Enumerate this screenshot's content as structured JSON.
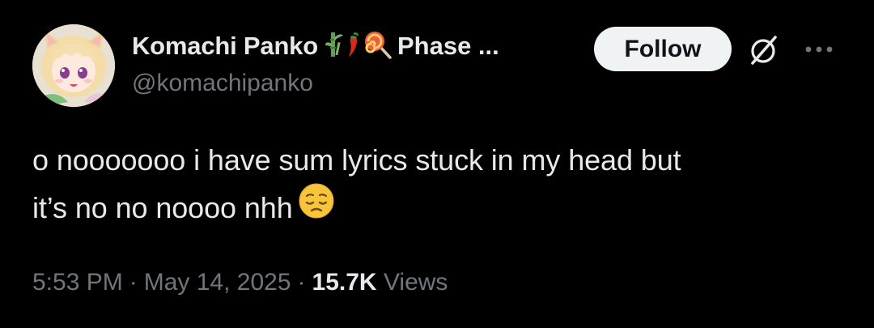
{
  "user": {
    "display_name": "Komachi Panko",
    "name_suffix": "Phase ...",
    "handle": "@komachipanko",
    "name_emojis": [
      "bamboo-icon",
      "chili-pepper-icon",
      "lollipop-icon"
    ]
  },
  "actions": {
    "follow_label": "Follow",
    "grok_icon": "grok-icon",
    "more_icon": "more-icon"
  },
  "tweet": {
    "line1": "o nooooooo i have sum lyrics stuck in my head but",
    "line2": "it’s no no noooo nhh",
    "emoji": "pensive-face-icon"
  },
  "meta": {
    "time": "5:53 PM",
    "date": "May 14, 2025",
    "separator": "·",
    "views_count": "15.7K",
    "views_label": "Views"
  },
  "colors": {
    "background": "#000000",
    "text_primary": "#e7e9ea",
    "text_secondary": "#71767b",
    "follow_bg": "#eff3f4",
    "follow_text": "#0f1419"
  }
}
